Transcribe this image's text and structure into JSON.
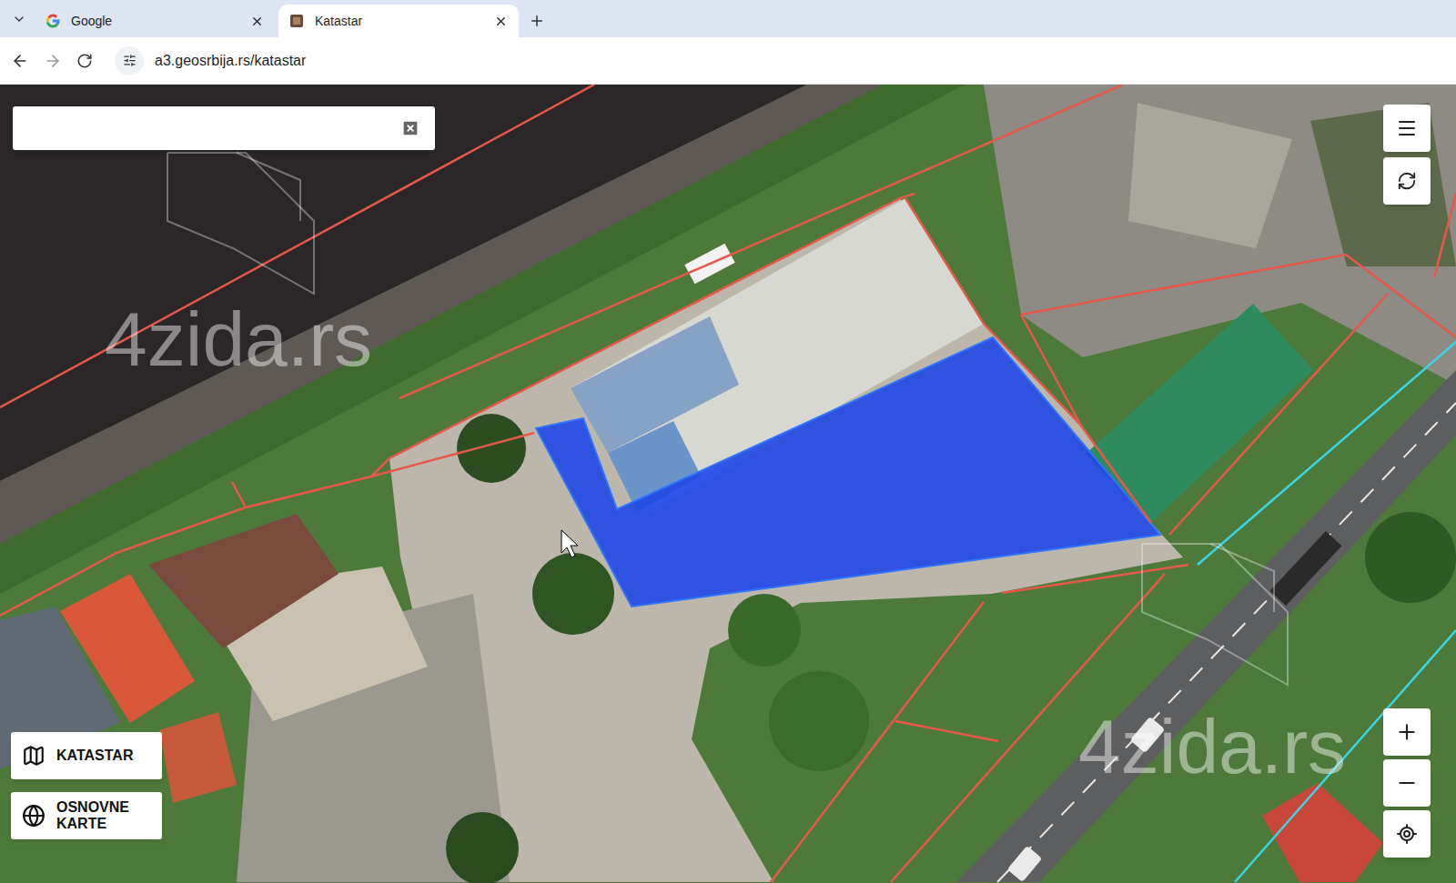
{
  "browser": {
    "tabs": [
      {
        "label": "Google",
        "selected": false
      },
      {
        "label": "Katastar",
        "selected": true
      }
    ],
    "url": "a3.geosrbija.rs/katastar"
  },
  "map": {
    "watermarks": [
      "4zida.rs",
      "4zida.rs"
    ],
    "selected_parcel": {
      "selected": true
    }
  },
  "layer_buttons": [
    {
      "label": "KATASTAR"
    },
    {
      "label": "OSNOVNE KARTE"
    }
  ]
}
